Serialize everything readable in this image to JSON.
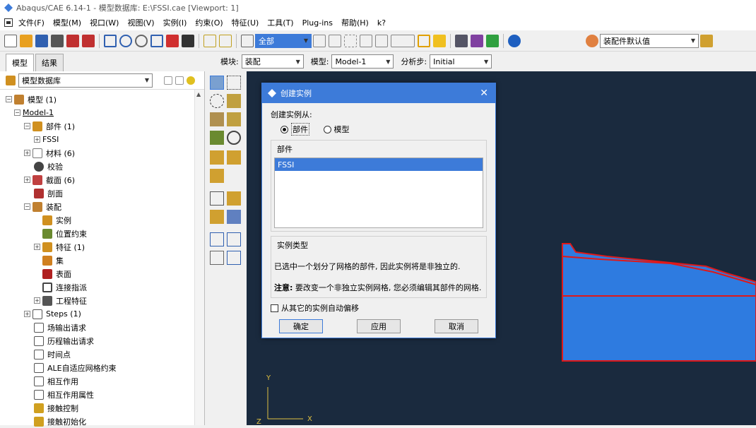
{
  "title": "Abaqus/CAE 6.14-1 - 模型数据库: E:\\FSSI.cae [Viewport: 1]",
  "menu": [
    "文件(F)",
    "模型(M)",
    "视口(W)",
    "视图(V)",
    "实例(I)",
    "约束(O)",
    "特征(U)",
    "工具(T)",
    "Plug-ins",
    "帮助(H)",
    "k?"
  ],
  "toolbar": {
    "select_all": "全部",
    "assembly_default": "装配件默认值"
  },
  "tabs": [
    "模型",
    "结果"
  ],
  "module_bar": {
    "module_label": "模块:",
    "module_value": "装配",
    "model_label": "模型:",
    "model_value": "Model-1",
    "step_label": "分析步:",
    "step_value": "Initial"
  },
  "tree_header": "模型数据库",
  "tree": [
    {
      "label": "模型 (1)"
    },
    {
      "label": "Model-1"
    },
    {
      "label": "部件 (1)"
    },
    {
      "label": "FSSI"
    },
    {
      "label": "材料 (6)"
    },
    {
      "label": "校验"
    },
    {
      "label": "截面 (6)"
    },
    {
      "label": "剖面"
    },
    {
      "label": "装配"
    },
    {
      "label": "实例"
    },
    {
      "label": "位置约束"
    },
    {
      "label": "特征 (1)"
    },
    {
      "label": "集"
    },
    {
      "label": "表面"
    },
    {
      "label": "连接指派"
    },
    {
      "label": "工程特征"
    },
    {
      "label": "Steps (1)"
    },
    {
      "label": "场输出请求"
    },
    {
      "label": "历程输出请求"
    },
    {
      "label": "时间点"
    },
    {
      "label": "ALE自适应网格约束"
    },
    {
      "label": "相互作用"
    },
    {
      "label": "相互作用属性"
    },
    {
      "label": "接触控制"
    },
    {
      "label": "接触初始化"
    }
  ],
  "dialog": {
    "title": "创建实例",
    "create_from": "创建实例从:",
    "opt_part": "部件",
    "opt_model": "模型",
    "parts_group": "部件",
    "parts": [
      "FSSI"
    ],
    "instance_type_group": "实例类型",
    "instance_msg": "已选中一个划分了网格的部件, 因此实例将是非独立的.",
    "note_label": "注意:",
    "note_text": "要改变一个非独立实例网格, 您必须编辑其部件的网格.",
    "auto_offset": "从其它的实例自动偏移",
    "ok": "确定",
    "apply": "应用",
    "cancel": "取消"
  },
  "triad": {
    "y": "Y",
    "x": "X",
    "z": "Z"
  },
  "colors": {
    "accent": "#3d7bd9",
    "viewport": "#1a2a3e",
    "part_fill": "#2e7be0",
    "part_edge": "#e01818"
  }
}
